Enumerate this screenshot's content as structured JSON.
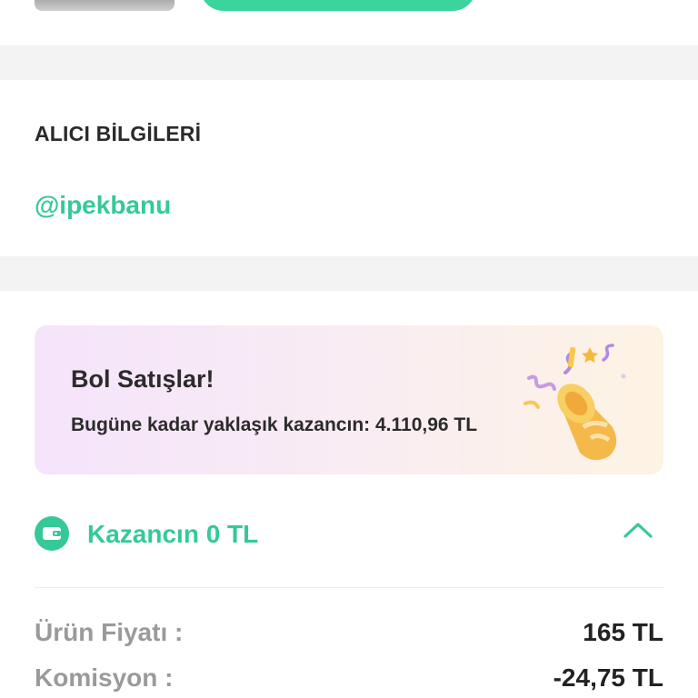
{
  "buyer": {
    "title": "ALICI BİLGİLERİ",
    "username": "@ipekbanu"
  },
  "promo": {
    "title": "Bol Satışlar!",
    "text": "Bugüne kadar yaklaşık kazancın: 4.110,96 TL",
    "icon": "party-popper-icon"
  },
  "earnings": {
    "label": "Kazancın 0 TL",
    "icon": "wallet-icon",
    "toggle_icon": "chevron-up-icon"
  },
  "breakdown": [
    {
      "label": "Ürün Fiyatı :",
      "value": "165 TL"
    },
    {
      "label": "Komisyon :",
      "value": "-24,75 TL"
    }
  ],
  "colors": {
    "accent": "#35c999",
    "section_gap": "#f3f3f3",
    "muted_text": "#9a9a9a"
  }
}
